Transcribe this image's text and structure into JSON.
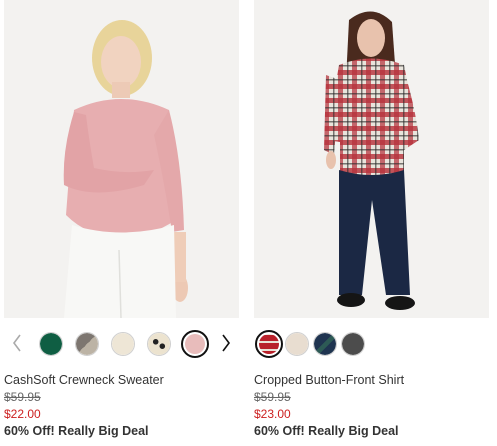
{
  "products": [
    {
      "name": "CashSoft Crewneck Sweater",
      "original_price": "$59.95",
      "sale_price": "$22.00",
      "promo": "60% Off! Really Big Deal",
      "image": "woman-in-pink-sweater-photo",
      "swatches": [
        {
          "name": "green",
          "color": "#0f5e43"
        },
        {
          "name": "gray-tan",
          "color": "#9a948c"
        },
        {
          "name": "cream",
          "color": "#eee6d6"
        },
        {
          "name": "cream-dots",
          "color": "#ece3cf"
        },
        {
          "name": "pink",
          "color": "#e8bcbb",
          "selected": true
        }
      ],
      "prev_icon": "chevron-left-icon",
      "next_icon": "chevron-right-icon"
    },
    {
      "name": "Cropped Button-Front Shirt",
      "original_price": "$59.95",
      "sale_price": "$23.00",
      "promo": "60% Off! Really Big Deal",
      "image": "woman-in-plaid-shirt-photo",
      "swatches": [
        {
          "name": "red-plaid",
          "color": "#b8202a",
          "selected": true
        },
        {
          "name": "beige",
          "color": "#e8ddd0"
        },
        {
          "name": "navy-plaid",
          "color": "#1f3450"
        },
        {
          "name": "charcoal",
          "color": "#4c4c4c"
        }
      ]
    }
  ]
}
